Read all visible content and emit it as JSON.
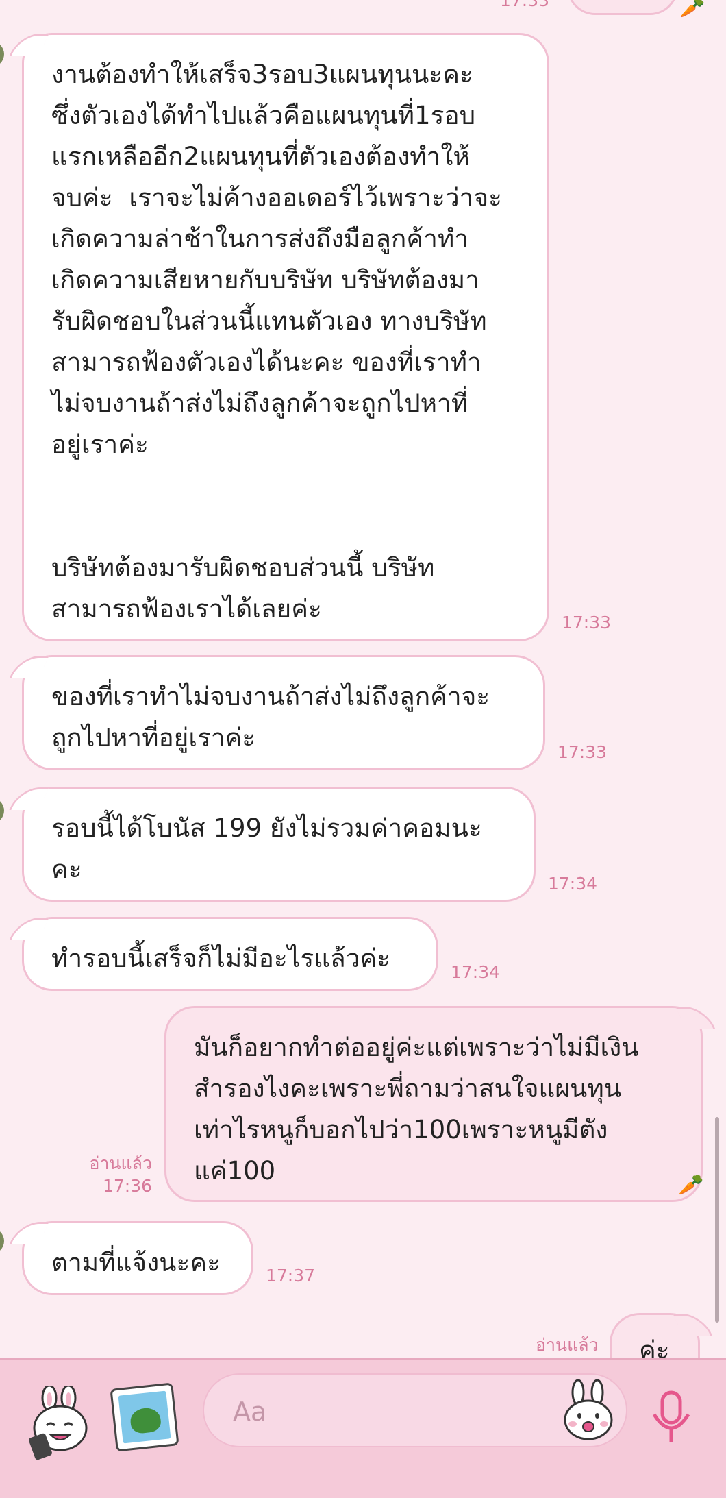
{
  "chat": {
    "top_time_partial": "17:33",
    "messages": [
      {
        "side": "in",
        "text": "งานต้องทำให้เสร็จ3รอบ3แผนทุนนะคะ\nซึ่งตัวเองได้ทำไปแล้วคือแผนทุนที่1รอบ\nแรกเหลืออีก2แผนทุนที่ตัวเองต้องทำให้\nจบค่ะ  เราจะไม่ค้างออเดอร์ไว้เพราะว่าจะ\nเกิดความล่าช้าในการส่งถึงมือลูกค้าทำ\nเกิดความเสียหายกับบริษัท บริษัทต้องมา\nรับผิดชอบในส่วนนี้แทนตัวเอง ทางบริษัท\nสามารถฟ้องตัวเองได้นะคะ ของที่เราทำ\nไม่จบงานถ้าส่งไม่ถึงลูกค้าจะถูกไปหาที่\nอยู่เราค่ะ\n\n\nบริษัทต้องมารับผิดชอบส่วนนี้ บริษัท\nสามารถฟ้องเราได้เลยค่ะ",
        "time": "17:33"
      },
      {
        "side": "in",
        "text": "ของที่เราทำไม่จบงานถ้าส่งไม่ถึงลูกค้าจะ\nถูกไปหาที่อยู่เราค่ะ",
        "time": "17:33"
      },
      {
        "side": "in",
        "text": "รอบนี้ได้โบนัส 199 ยังไม่รวมค่าคอมนะ\nคะ",
        "time": "17:34"
      },
      {
        "side": "in",
        "text": "ทำรอบนี้เสร็จก็ไม่มีอะไรแล้วค่ะ",
        "time": "17:34"
      },
      {
        "side": "out",
        "text": "มันก็อยากทำต่ออยู่ค่ะแต่เพราะว่าไม่มีเงิน\nสำรองไงคะเพราะพี่ถามว่าสนใจแผนทุน\nเท่าไรหนูก็บอกไปว่า100เพราะหนูมีตัง\nแค่100",
        "read": "อ่านแล้ว",
        "time": "17:36"
      },
      {
        "side": "in",
        "text": "ตามที่แจ้งนะคะ",
        "time": "17:37"
      },
      {
        "side": "out",
        "text": "ค่ะ",
        "read": "อ่านแล้ว",
        "time": ""
      }
    ]
  },
  "composer": {
    "placeholder": "Aa",
    "icons": {
      "sticker": "sticker-icon",
      "photo": "photo-icon",
      "emoji": "emoji-icon",
      "mic": "mic-icon"
    }
  },
  "colors": {
    "background": "#fcedf2",
    "bubble_border": "#f1bfd2",
    "outgoing_bubble": "#fbe4ec",
    "time_text": "#d77a9a",
    "composer_bar": "#f5cad9",
    "mic": "#e5578c"
  }
}
